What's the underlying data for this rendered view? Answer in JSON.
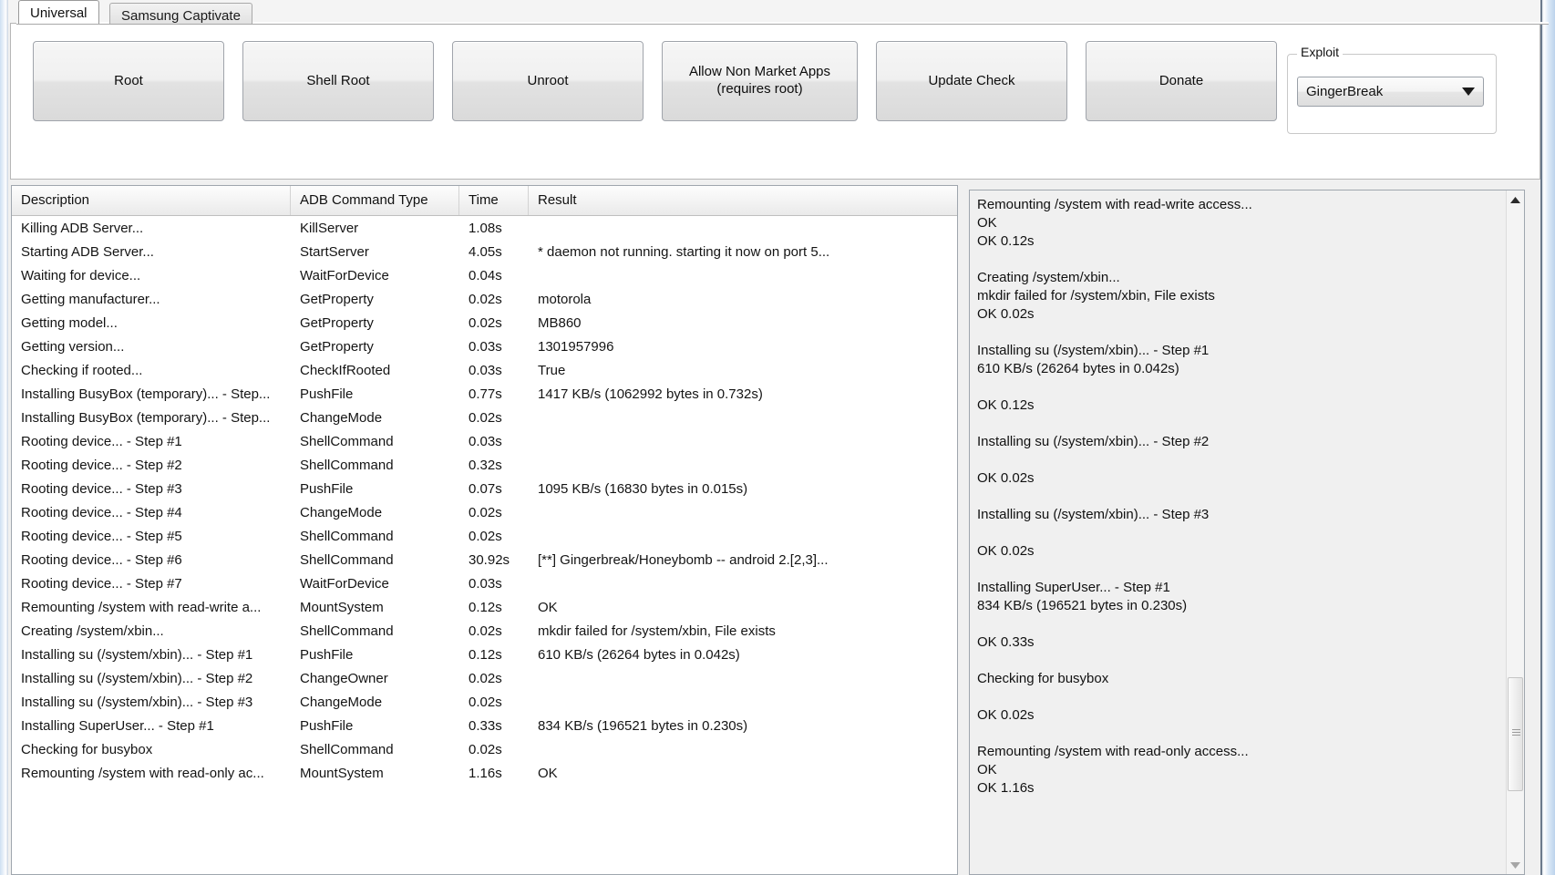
{
  "window": {
    "tabs": [
      {
        "label": "Universal",
        "active": true
      },
      {
        "label": "Samsung Captivate",
        "active": false
      }
    ]
  },
  "toolbar": {
    "root_label": "Root",
    "shell_root_label": "Shell Root",
    "unroot_label": "Unroot",
    "allow_non_market_label": "Allow Non Market Apps\n(requires root)",
    "update_check_label": "Update Check",
    "donate_label": "Donate"
  },
  "exploit": {
    "legend": "Exploit",
    "selected": "GingerBreak",
    "options": [
      "GingerBreak"
    ],
    "dropdown_icon": "chevron-down-icon"
  },
  "grid": {
    "columns": [
      "Description",
      "ADB Command Type",
      "Time",
      "Result"
    ],
    "rows": [
      {
        "description": "Killing ADB Server...",
        "type": "KillServer",
        "time": "1.08s",
        "result": ""
      },
      {
        "description": "Starting ADB Server...",
        "type": "StartServer",
        "time": "4.05s",
        "result": "* daemon not running. starting it now on port 5..."
      },
      {
        "description": "Waiting for device...",
        "type": "WaitForDevice",
        "time": "0.04s",
        "result": ""
      },
      {
        "description": "Getting manufacturer...",
        "type": "GetProperty",
        "time": "0.02s",
        "result": "motorola"
      },
      {
        "description": "Getting model...",
        "type": "GetProperty",
        "time": "0.02s",
        "result": "MB860"
      },
      {
        "description": "Getting version...",
        "type": "GetProperty",
        "time": "0.03s",
        "result": "1301957996"
      },
      {
        "description": "Checking if rooted...",
        "type": "CheckIfRooted",
        "time": "0.03s",
        "result": "True"
      },
      {
        "description": "Installing BusyBox (temporary)... - Step...",
        "type": "PushFile",
        "time": "0.77s",
        "result": "1417 KB/s (1062992 bytes in 0.732s)"
      },
      {
        "description": "Installing BusyBox (temporary)... - Step...",
        "type": "ChangeMode",
        "time": "0.02s",
        "result": ""
      },
      {
        "description": "Rooting device... - Step #1",
        "type": "ShellCommand",
        "time": "0.03s",
        "result": ""
      },
      {
        "description": "Rooting device... - Step #2",
        "type": "ShellCommand",
        "time": "0.32s",
        "result": ""
      },
      {
        "description": "Rooting device... - Step #3",
        "type": "PushFile",
        "time": "0.07s",
        "result": "1095 KB/s (16830 bytes in 0.015s)"
      },
      {
        "description": "Rooting device... - Step #4",
        "type": "ChangeMode",
        "time": "0.02s",
        "result": ""
      },
      {
        "description": "Rooting device... - Step #5",
        "type": "ShellCommand",
        "time": "0.02s",
        "result": ""
      },
      {
        "description": "Rooting device... - Step #6",
        "type": "ShellCommand",
        "time": "30.92s",
        "result": "[**] Gingerbreak/Honeybomb -- android 2.[2,3]..."
      },
      {
        "description": "Rooting device... - Step #7",
        "type": "WaitForDevice",
        "time": "0.03s",
        "result": ""
      },
      {
        "description": "Remounting /system with read-write a...",
        "type": "MountSystem",
        "time": "0.12s",
        "result": "OK"
      },
      {
        "description": "Creating /system/xbin...",
        "type": "ShellCommand",
        "time": "0.02s",
        "result": "mkdir failed for /system/xbin, File exists"
      },
      {
        "description": "Installing su (/system/xbin)... - Step #1",
        "type": "PushFile",
        "time": "0.12s",
        "result": "610 KB/s (26264 bytes in 0.042s)"
      },
      {
        "description": "Installing su (/system/xbin)... - Step #2",
        "type": "ChangeOwner",
        "time": "0.02s",
        "result": ""
      },
      {
        "description": "Installing su (/system/xbin)... - Step #3",
        "type": "ChangeMode",
        "time": "0.02s",
        "result": ""
      },
      {
        "description": "Installing SuperUser... - Step #1",
        "type": "PushFile",
        "time": "0.33s",
        "result": "834 KB/s (196521 bytes in 0.230s)"
      },
      {
        "description": "Checking for busybox",
        "type": "ShellCommand",
        "time": "0.02s",
        "result": ""
      },
      {
        "description": "Remounting /system with read-only ac...",
        "type": "MountSystem",
        "time": "1.16s",
        "result": "OK"
      }
    ]
  },
  "log": {
    "text": "Remounting /system with read-write access...\nOK\nOK 0.12s\n\nCreating /system/xbin...\nmkdir failed for /system/xbin, File exists\nOK 0.02s\n\nInstalling su (/system/xbin)... - Step #1\n610 KB/s (26264 bytes in 0.042s)\n\nOK 0.12s\n\nInstalling su (/system/xbin)... - Step #2\n\nOK 0.02s\n\nInstalling su (/system/xbin)... - Step #3\n\nOK 0.02s\n\nInstalling SuperUser... - Step #1\n834 KB/s (196521 bytes in 0.230s)\n\nOK 0.33s\n\nChecking for busybox\n\nOK 0.02s\n\nRemounting /system with read-only access...\nOK\nOK 1.16s",
    "scrollbar": {
      "up_icon": "scroll-up-arrow-icon",
      "down_icon": "scroll-down-arrow-icon",
      "thumb": "scroll-thumb"
    }
  },
  "colors": {
    "window_bg": "#f0f0f0",
    "panel_bg": "#ffffff",
    "log_bg": "#f0f0f0",
    "border": "#9fa6ae",
    "frame_accent": "#bcd3ec"
  }
}
